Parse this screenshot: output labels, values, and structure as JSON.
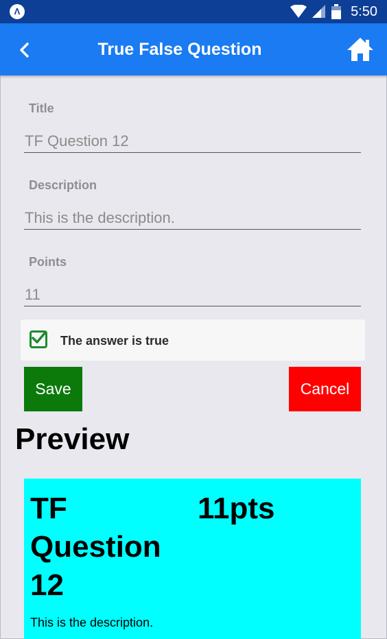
{
  "status_bar": {
    "time": "5:50",
    "app_icon": "expo-logo-icon",
    "app_icon_glyph": "Λ",
    "icons": [
      "wifi-icon",
      "cell-signal-icon",
      "battery-icon"
    ],
    "color": "#0d3f96"
  },
  "header": {
    "title": "True False Question",
    "back_icon": "chevron-left-icon",
    "home_icon": "home-icon",
    "color": "#1a7bf2"
  },
  "form": {
    "title_label": "Title",
    "title_value": "TF Question 12",
    "description_label": "Description",
    "description_value": "This is the description.",
    "points_label": "Points",
    "points_value": "11",
    "answer_checkbox_label": "The answer is true",
    "answer_checked": true
  },
  "actions": {
    "save_label": "Save",
    "cancel_label": "Cancel",
    "save_color": "#0b7a0b",
    "cancel_color": "#ff0000"
  },
  "preview": {
    "heading": "Preview",
    "card_title": "TF Question 12",
    "card_points": "11pts",
    "card_description": "This is the description.",
    "card_color": "#00ffff"
  }
}
